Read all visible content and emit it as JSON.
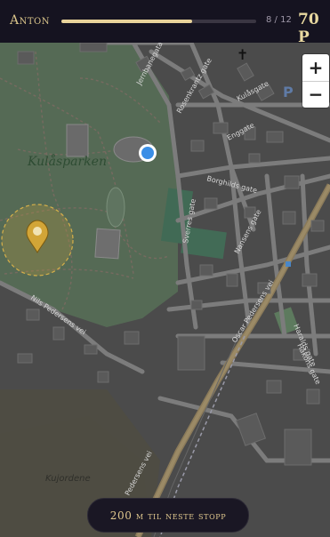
{
  "header": {
    "player_name": "Anton",
    "progress_fraction": 0.67,
    "stop_counter": "8 / 12",
    "points": "70 P"
  },
  "map": {
    "labels": {
      "park": "Kulåsparken",
      "field": "Kujordene",
      "street_jernbane": "Jernbanegata",
      "street_rosenkrantz": "Rosenkrantz gate",
      "street_kulas": "Kulåsgate",
      "street_eng": "Enggate",
      "street_borghild": "Borghilds gate",
      "street_sverre": "Sverres gate",
      "street_nansen": "Nansens gate",
      "street_nils": "Nils Pedersens vei",
      "street_oscar": "Oscar Pedersens vei",
      "street_harald": "Haralds gate",
      "street_hakon": "Håkons gate",
      "street_oscar_lower": "Pedersens vei",
      "parking": "P",
      "church": "✝"
    },
    "zoom_in_label": "+",
    "zoom_out_label": "−"
  },
  "footer": {
    "next_stop_text": "200 m til neste stopp"
  },
  "colors": {
    "accent_gold": "#e8d39a",
    "topbar_bg": "#151320",
    "user_dot": "#3a8ee6",
    "marker": "#c9a13a"
  },
  "icons": {
    "user_location": "user-location-icon",
    "destination": "map-pin-icon",
    "church": "church-icon",
    "parking": "parking-icon"
  }
}
